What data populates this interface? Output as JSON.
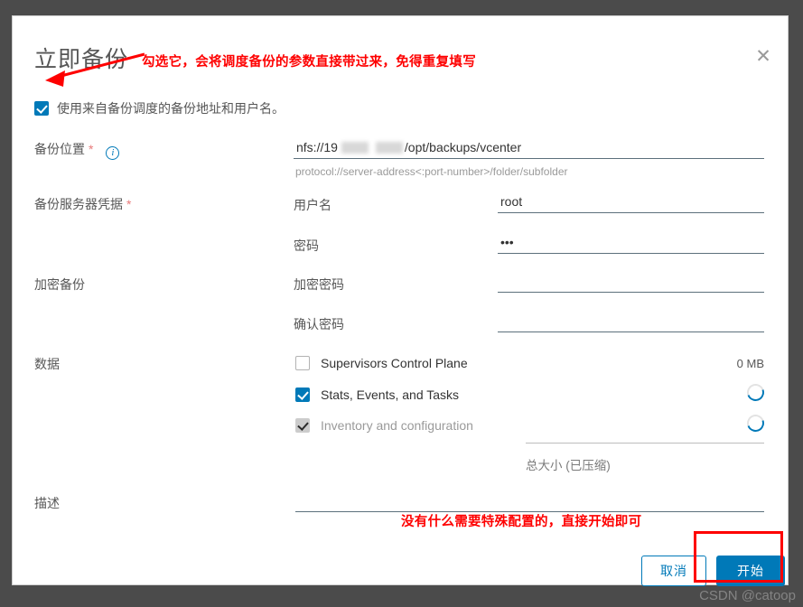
{
  "dialog": {
    "title": "立即备份",
    "close_icon": "close-icon"
  },
  "annotations": {
    "top": "勾选它，会将调度备份的参数直接带过来，免得重复填写",
    "bottom": "没有什么需要特殊配置的，直接开始即可",
    "color": "#fe0000"
  },
  "use_schedule": {
    "label": "使用来自备份调度的备份地址和用户名。",
    "checked": true
  },
  "fields": {
    "location": {
      "label": "备份位置",
      "required": "*",
      "info_icon": "info-icon",
      "value_prefix": "nfs://19",
      "value_suffix": "/opt/backups/vcenter",
      "help": "protocol://server-address<:port-number>/folder/subfolder"
    },
    "credentials": {
      "label": "备份服务器凭据",
      "required": "*",
      "username": {
        "label": "用户名",
        "value": "root"
      },
      "password": {
        "label": "密码",
        "value": "•••"
      }
    },
    "encryption": {
      "label": "加密备份",
      "encrypt_password": {
        "label": "加密密码",
        "value": ""
      },
      "confirm_password": {
        "label": "确认密码",
        "value": ""
      }
    },
    "description": {
      "label": "描述",
      "value": ""
    }
  },
  "data_section": {
    "label": "数据",
    "items": [
      {
        "label": "Supervisors Control Plane",
        "checked": false,
        "disabled": false,
        "size": "0 MB",
        "loading": false
      },
      {
        "label": "Stats, Events, and Tasks",
        "checked": true,
        "disabled": false,
        "size": "",
        "loading": true
      },
      {
        "label": "Inventory and configuration",
        "checked": true,
        "disabled": true,
        "size": "",
        "loading": true
      }
    ],
    "total_label": "总大小 (已压缩)"
  },
  "footer": {
    "cancel_label": "取消",
    "start_label": "开始",
    "accent_color": "#0079b8"
  },
  "watermark": "CSDN @catoop"
}
